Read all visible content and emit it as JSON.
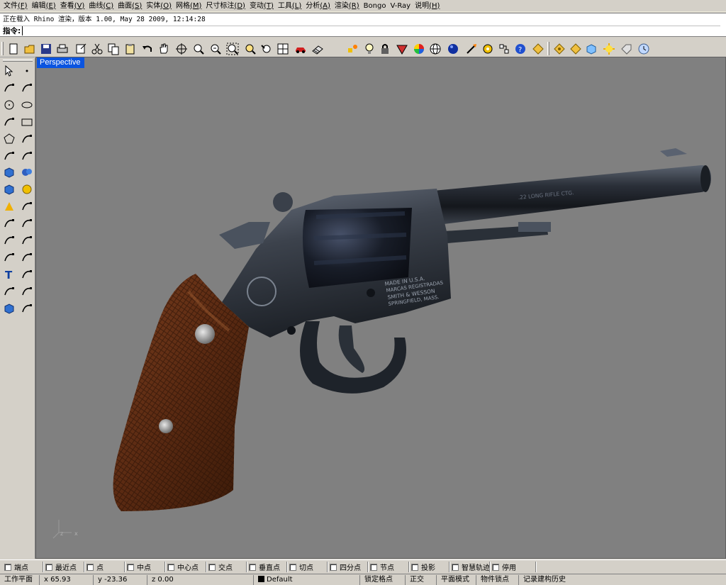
{
  "menu": [
    {
      "label": "文件",
      "key": "(F)"
    },
    {
      "label": "编辑",
      "key": "(E)"
    },
    {
      "label": "查看",
      "key": "(V)"
    },
    {
      "label": "曲线",
      "key": "(C)"
    },
    {
      "label": "曲面",
      "key": "(S)"
    },
    {
      "label": "实体",
      "key": "(O)"
    },
    {
      "label": "网格",
      "key": "(M)"
    },
    {
      "label": "尺寸标注",
      "key": "(D)"
    },
    {
      "label": "变动",
      "key": "(T)"
    },
    {
      "label": "工具",
      "key": "(L)"
    },
    {
      "label": "分析",
      "key": "(A)"
    },
    {
      "label": "渲染",
      "key": "(R)"
    },
    {
      "label": "Bongo",
      "key": ""
    },
    {
      "label": "V-Ray",
      "key": ""
    },
    {
      "label": "说明",
      "key": "(H)"
    }
  ],
  "command": {
    "history": "正在载入 Rhino 渲染，版本 1.00, May 28 2009, 12:14:28",
    "prompt": "指令:",
    "value": ""
  },
  "viewport": {
    "title": "Perspective",
    "axis_labels": {
      "x": "x",
      "z": "z"
    }
  },
  "osnap": [
    {
      "label": "端点",
      "checked": false
    },
    {
      "label": "最近点",
      "checked": false
    },
    {
      "label": "点",
      "checked": false
    },
    {
      "label": "中点",
      "checked": false
    },
    {
      "label": "中心点",
      "checked": false
    },
    {
      "label": "交点",
      "checked": false
    },
    {
      "label": "垂直点",
      "checked": false
    },
    {
      "label": "切点",
      "checked": false
    },
    {
      "label": "四分点",
      "checked": false
    },
    {
      "label": "节点",
      "checked": false
    },
    {
      "label": "投影",
      "checked": false
    },
    {
      "label": "智慧轨迹",
      "checked": false
    },
    {
      "label": "停用",
      "checked": false
    }
  ],
  "status": {
    "cplane": "工作平面",
    "x": "x 65.93",
    "y": "y -23.36",
    "z": "z 0.00",
    "layer": "Default",
    "layer_color": "#000000",
    "grid_snap": "锁定格点",
    "ortho": "正交",
    "planar": "平面模式",
    "osnap": "物件锁点",
    "history": "记录建构历史"
  },
  "toolbar_icons": [
    "new-icon",
    "open-icon",
    "save-icon",
    "print-icon",
    "import-icon",
    "cut-icon",
    "copy-icon",
    "paste-icon",
    "undo-icon",
    "pan-icon",
    "rotate-view-icon",
    "zoom-window-icon",
    "zoom-dynamic-icon",
    "zoom-extents-icon",
    "zoom-selected-icon",
    "undo-view-icon",
    "four-viewports-icon",
    "car-icon",
    "grid-icon",
    "select-points-icon",
    "light-icon",
    "lock-icon",
    "shade-icon",
    "color-wheel-icon",
    "wireframe-sphere-icon",
    "render-sphere-icon",
    "render-icon",
    "gear-icon",
    "options-icon",
    "help-icon",
    "bongo-m-icon",
    "bongo-o-icon",
    "bongo-f-icon",
    "bongo-cube-icon",
    "bongo-sun-icon",
    "bongo-tag-icon",
    "bongo-clock-icon"
  ],
  "gun_stamp": {
    "lines": [
      "MADE IN U.S.A.",
      "MARCAS REGISTRADAS",
      "SMITH & WESSON",
      "SPRINGFIELD, MASS."
    ],
    "barrel": ".22 LONG RIFLE CTG."
  },
  "colors": {
    "viewport_bg": "#808080",
    "title_bg": "#0a54e0",
    "chrome": "#d4d0c8"
  }
}
